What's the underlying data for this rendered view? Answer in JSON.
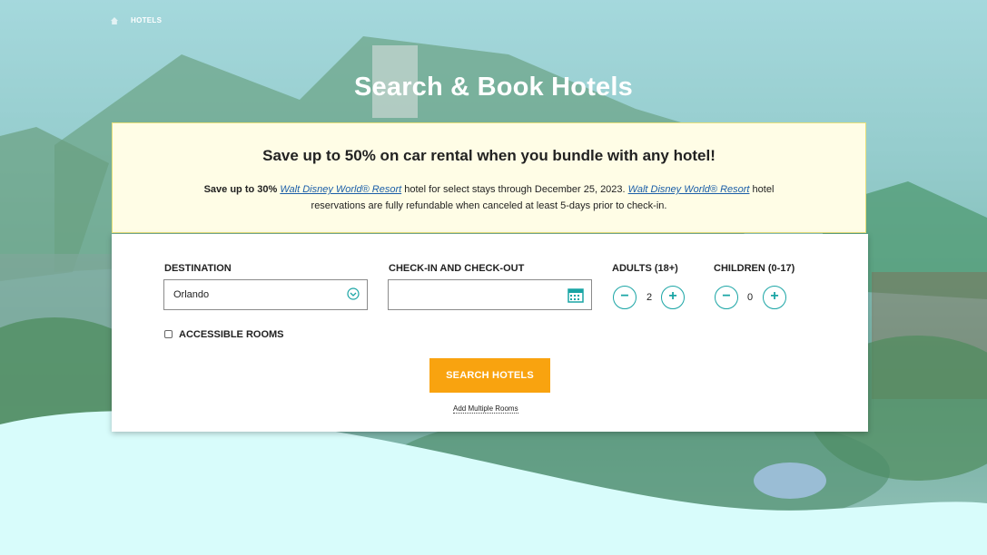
{
  "breadcrumb": {
    "home_icon": "home-icon",
    "current": "HOTELS"
  },
  "page_title": "Search & Book Hotels",
  "promo": {
    "headline": "Save up to 50% on car rental when you bundle with any hotel!",
    "line_bold": "Save up to 30%",
    "link1": "Walt Disney World® Resort",
    "line_mid": "hotel for select stays through December 25, 2023.",
    "link2": "Walt Disney World® Resort",
    "line_end": "hotel reservations are fully refundable when canceled at least 5-days prior to check-in."
  },
  "form": {
    "destination_label": "DESTINATION",
    "destination_value": "Orlando",
    "dates_label": "CHECK-IN AND CHECK-OUT",
    "dates_value": "",
    "adults_label": "ADULTS (18+)",
    "adults_value": "2",
    "children_label": "CHILDREN (0-17)",
    "children_value": "0",
    "minus_symbol": "−",
    "plus_symbol": "+",
    "accessible_label": "ACCESSIBLE ROOMS",
    "search_button": "SEARCH HOTELS",
    "add_rooms_link": "Add Multiple Rooms"
  },
  "colors": {
    "accent": "#1aa5a5",
    "button": "#f9a30f",
    "promo_bg": "#fffde6",
    "wave": "#d8fcfb"
  }
}
